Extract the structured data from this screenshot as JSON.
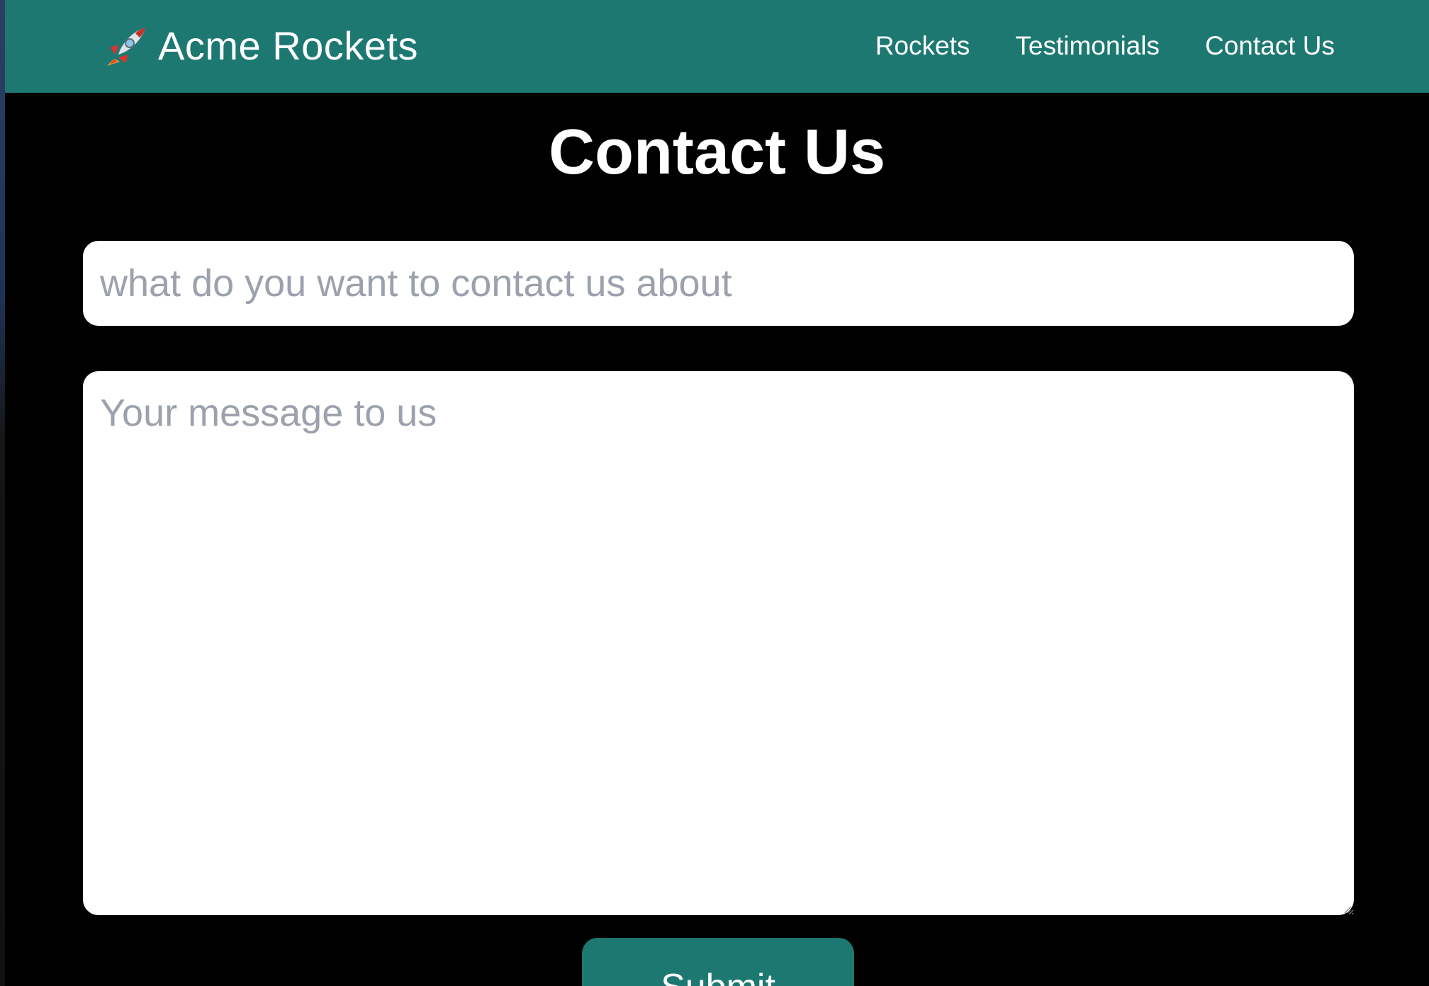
{
  "colors": {
    "brand_teal": "#1d7872",
    "background": "#000000",
    "placeholder_gray": "#9ba1ad",
    "white": "#ffffff"
  },
  "navbar": {
    "brand": {
      "icon": "rocket-icon",
      "label": "Acme Rockets"
    },
    "links": [
      {
        "label": "Rockets"
      },
      {
        "label": "Testimonials"
      },
      {
        "label": "Contact Us"
      }
    ]
  },
  "main": {
    "title": "Contact Us",
    "form": {
      "subject": {
        "value": "",
        "placeholder": "what do you want to contact us about"
      },
      "message": {
        "value": "",
        "placeholder": "Your message to us"
      },
      "submit_label": "Submit"
    }
  }
}
